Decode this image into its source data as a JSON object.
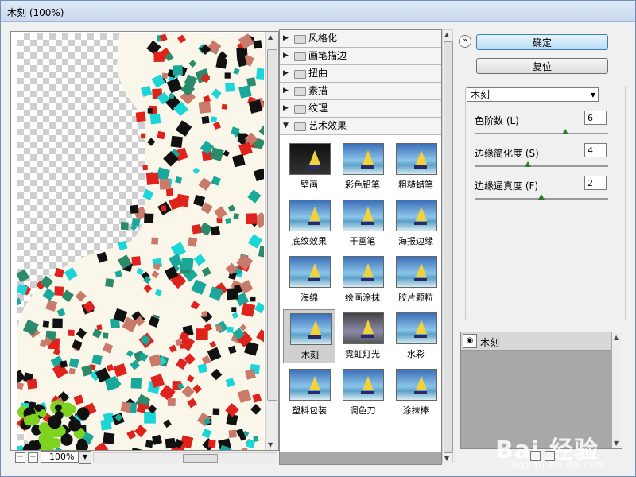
{
  "window": {
    "title": "木刻 (100%)"
  },
  "preview": {
    "zoom": "100%"
  },
  "gallery": {
    "categories": [
      {
        "label": "风格化",
        "expanded": false
      },
      {
        "label": "画笔描边",
        "expanded": false
      },
      {
        "label": "扭曲",
        "expanded": false
      },
      {
        "label": "素描",
        "expanded": false
      },
      {
        "label": "纹理",
        "expanded": false
      },
      {
        "label": "艺术效果",
        "expanded": true
      }
    ],
    "filters": [
      "壁画",
      "彩色铅笔",
      "粗糙蜡笔",
      "底纹效果",
      "干画笔",
      "海报边缘",
      "海绵",
      "绘画涂抹",
      "胶片颗粒",
      "木刻",
      "霓虹灯光",
      "水彩",
      "塑料包装",
      "调色刀",
      "涂抹棒"
    ],
    "selected": "木刻"
  },
  "buttons": {
    "ok": "确定",
    "reset": "复位"
  },
  "filter_select": {
    "value": "木刻"
  },
  "params": [
    {
      "label": "色阶数 (L)",
      "value": "6",
      "level": 0.68
    },
    {
      "label": "边缘简化度 (S)",
      "value": "4",
      "level": 0.4
    },
    {
      "label": "边缘逼真度 (F)",
      "value": "2",
      "level": 0.5
    }
  ],
  "layers": [
    {
      "name": "木刻"
    }
  ],
  "watermark": {
    "main": "Bai 经验",
    "sub": "jingyan.baidu.com"
  },
  "colors": {
    "accent": "#3c7fb1",
    "frame": "#6f8fb5"
  }
}
